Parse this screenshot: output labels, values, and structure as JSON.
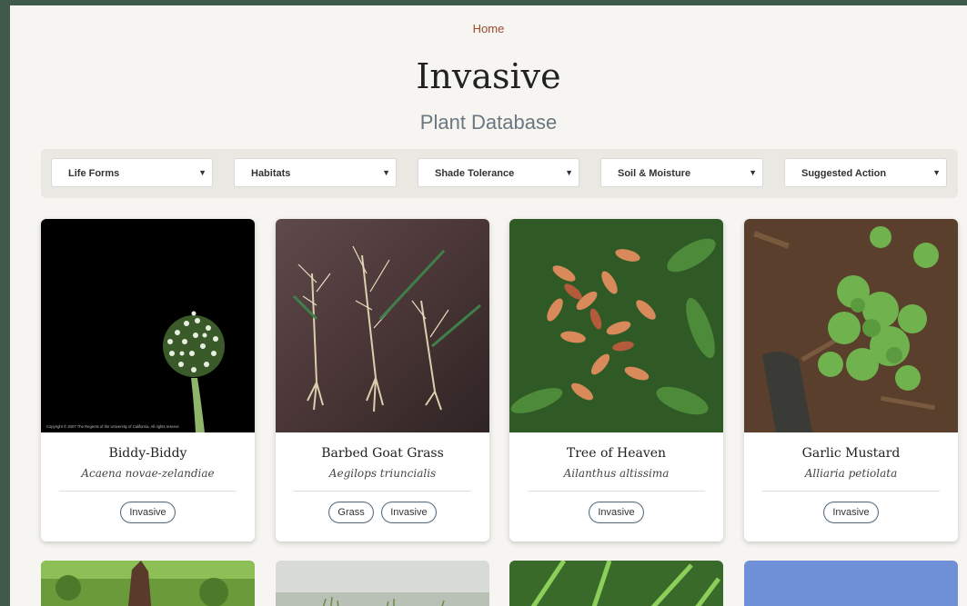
{
  "breadcrumb": {
    "home": "Home"
  },
  "header": {
    "title": "Invasive",
    "subtitle": "Plant Database"
  },
  "filters": [
    {
      "label": "Life Forms"
    },
    {
      "label": "Habitats"
    },
    {
      "label": "Shade Tolerance"
    },
    {
      "label": "Soil & Moisture"
    },
    {
      "label": "Suggested Action"
    }
  ],
  "cards": [
    {
      "name": "Biddy-Biddy",
      "scientific": "Acaena novae-zelandiae",
      "tags": [
        "Invasive"
      ],
      "photo_caption": "Copyright © 2007 The Regents of the University of California. All rights reserve"
    },
    {
      "name": "Barbed Goat Grass",
      "scientific": "Aegilops triuncialis",
      "tags": [
        "Grass",
        "Invasive"
      ]
    },
    {
      "name": "Tree of Heaven",
      "scientific": "Ailanthus altissima",
      "tags": [
        "Invasive"
      ]
    },
    {
      "name": "Garlic Mustard",
      "scientific": "Alliaria petiolata",
      "tags": [
        "Invasive"
      ]
    }
  ],
  "colors": {
    "accent": "#9a4a2c",
    "frame": "#3f5a4b",
    "background": "#f6f5f1",
    "tag_border": "#5a6b78"
  }
}
